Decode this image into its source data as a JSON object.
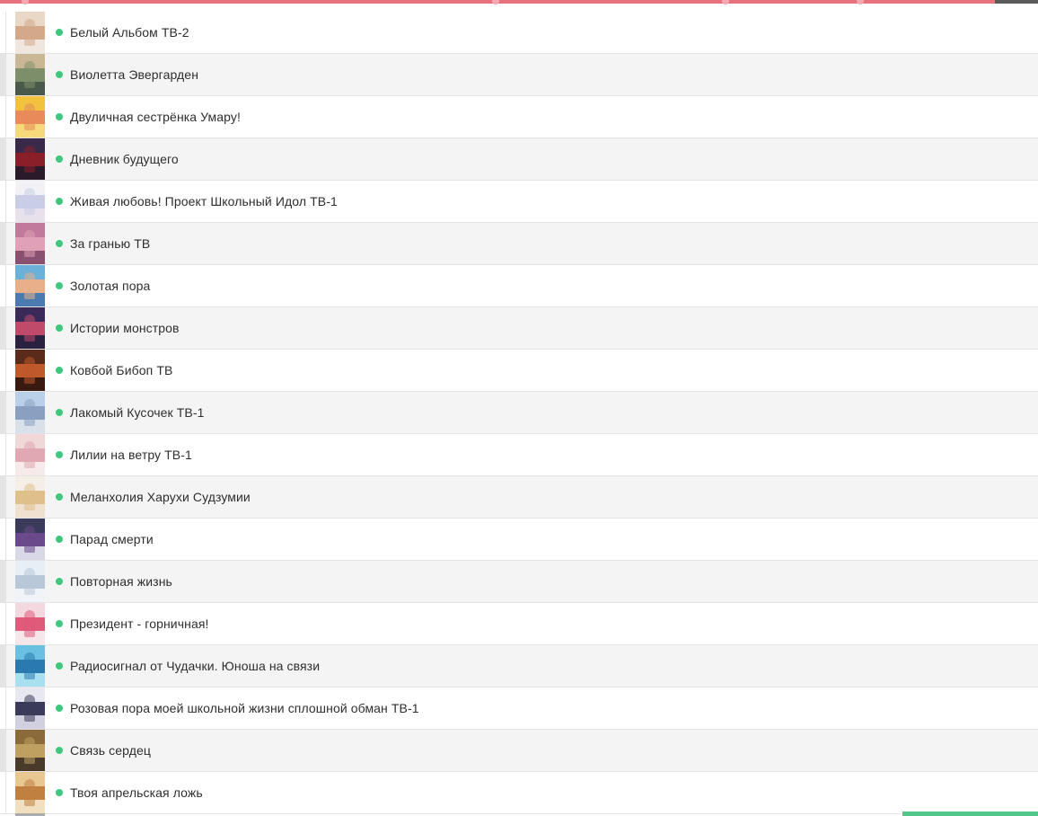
{
  "colors": {
    "status_dot": "#3fc77e",
    "top_bar": "#e8737f",
    "row_alt": "#f4f4f4",
    "row_border": "#e3e3e3",
    "text": "#2e2e2e",
    "bottom_accent": "#52c78a"
  },
  "list": {
    "items": [
      {
        "title": "Белый Альбом ТВ-2",
        "status": "green-dot",
        "thumb": [
          "#e9d8c6",
          "#d4a98a",
          "#f0e6de"
        ]
      },
      {
        "title": "Виолетта Эвергарден",
        "status": "green-dot",
        "thumb": [
          "#c9b893",
          "#7d8f6a",
          "#4a5a4a"
        ]
      },
      {
        "title": "Двуличная сестрёнка Умару!",
        "status": "green-dot",
        "thumb": [
          "#f2c23e",
          "#e88a5a",
          "#f5d97a"
        ]
      },
      {
        "title": "Дневник будущего",
        "status": "green-dot",
        "thumb": [
          "#3a2a4a",
          "#8a1f2a",
          "#2a1a2a"
        ]
      },
      {
        "title": "Живая любовь! Проект Школьный Идол ТВ-1",
        "status": "green-dot",
        "thumb": [
          "#f2f2f6",
          "#c9cde6",
          "#e8e0ea"
        ]
      },
      {
        "title": "За гранью ТВ",
        "status": "green-dot",
        "thumb": [
          "#c27a9a",
          "#e0a0b8",
          "#8a5070"
        ]
      },
      {
        "title": "Золотая пора",
        "status": "green-dot",
        "thumb": [
          "#6ab0d8",
          "#e8b08a",
          "#4a7ab0"
        ]
      },
      {
        "title": "Истории монстров",
        "status": "green-dot",
        "thumb": [
          "#3a2a5a",
          "#c04a6a",
          "#2a2040"
        ]
      },
      {
        "title": "Ковбой Бибоп ТВ",
        "status": "green-dot",
        "thumb": [
          "#5a2a1a",
          "#c05a2a",
          "#3a1a10"
        ]
      },
      {
        "title": "Лакомый Кусочек ТВ-1",
        "status": "green-dot",
        "thumb": [
          "#b8d0e8",
          "#8aa0c0",
          "#d8e0ea"
        ]
      },
      {
        "title": "Лилии на ветру ТВ-1",
        "status": "green-dot",
        "thumb": [
          "#f0d8d8",
          "#e0a8b0",
          "#f6eaea"
        ]
      },
      {
        "title": "Меланхолия Харухи Судзумии",
        "status": "green-dot",
        "thumb": [
          "#f4eee6",
          "#e0c08a",
          "#f0e0d0"
        ]
      },
      {
        "title": "Парад смерти",
        "status": "green-dot",
        "thumb": [
          "#3a3a5a",
          "#6a4a8a",
          "#d8d8e8"
        ]
      },
      {
        "title": "Повторная жизнь",
        "status": "green-dot",
        "thumb": [
          "#e8eef6",
          "#b8c8d8",
          "#f0f4f8"
        ]
      },
      {
        "title": "Президент - горничная!",
        "status": "green-dot",
        "thumb": [
          "#f4d8e0",
          "#e05a7a",
          "#f6e6ea"
        ]
      },
      {
        "title": "Радиосигнал от Чудачки. Юноша на связи",
        "status": "green-dot",
        "thumb": [
          "#6ac0e0",
          "#2a7ab0",
          "#a8e0f0"
        ]
      },
      {
        "title": "Розовая пора моей школьной жизни сплошной обман ТВ-1",
        "status": "green-dot",
        "thumb": [
          "#e8e8f0",
          "#3a3a5a",
          "#d0d0e0"
        ]
      },
      {
        "title": "Связь сердец",
        "status": "green-dot",
        "thumb": [
          "#8a6a3a",
          "#c0a060",
          "#4a3a2a"
        ]
      },
      {
        "title": "Твоя апрельская ложь",
        "status": "green-dot",
        "thumb": [
          "#e8c890",
          "#c08040",
          "#f0e0c0"
        ]
      }
    ]
  }
}
